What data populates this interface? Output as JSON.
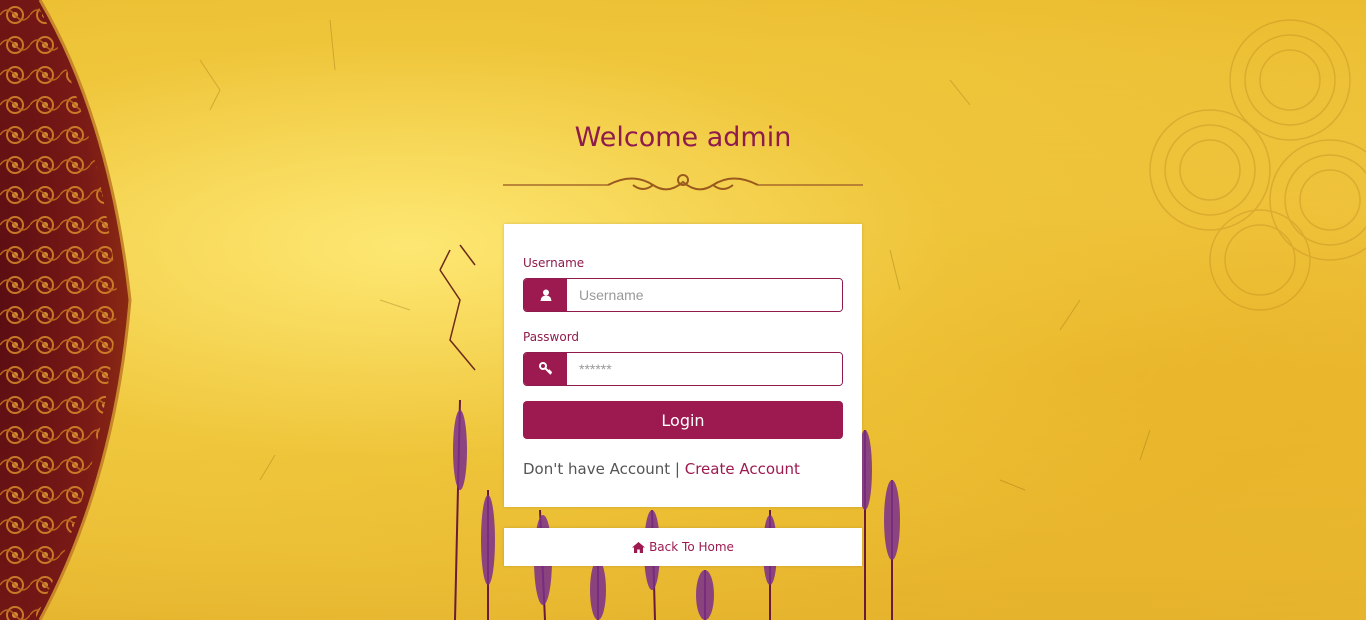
{
  "page": {
    "title": "Welcome admin"
  },
  "form": {
    "username_label": "Username",
    "username_placeholder": "Username",
    "username_value": "",
    "password_label": "Password",
    "password_placeholder": "******",
    "password_value": "",
    "login_label": "Login"
  },
  "account": {
    "prompt": "Don't have Account",
    "separator": " | ",
    "create_link": "Create Account"
  },
  "footer": {
    "back_home_label": "Back To Home"
  },
  "icons": {
    "username": "user-icon",
    "password": "key-icon",
    "home": "home-icon"
  },
  "colors": {
    "accent": "#9c1a4f",
    "title": "#8e1b4c",
    "background": "#edc53b"
  }
}
